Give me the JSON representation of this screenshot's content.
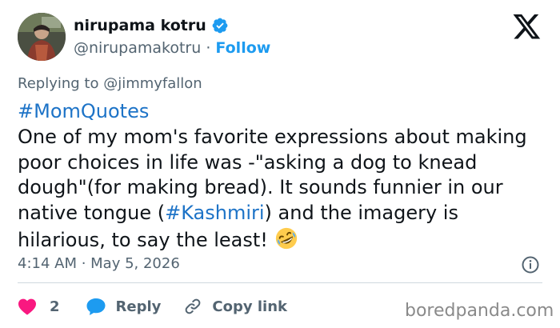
{
  "author": {
    "name": "nirupama kotru",
    "handle": "@nirupamakotru",
    "separator": " · ",
    "follow_label": "Follow"
  },
  "reply_to": "Replying to @jimmyfallon",
  "tweet": {
    "hashtag_top": "#MomQuotes",
    "text_part1": "One of my mom's favorite expressions about making poor choices in life was -\"asking a dog to knead dough\"(for making bread). It sounds funnier in our native tongue (",
    "hashtag_inline": "#Kashmiri",
    "text_part2": ") and the imagery is hilarious, to say the least! "
  },
  "timestamp": "4:14 AM · May 5, 2026",
  "actions": {
    "like_count": "2",
    "reply_label": "Reply",
    "copy_label": "Copy link"
  },
  "watermark": "boredpanda.com",
  "colors": {
    "link": "#1d73c7",
    "accent": "#1d9bf0",
    "like": "#f91880",
    "muted": "#536471"
  },
  "icons": [
    "verified-badge-icon",
    "x-logo-icon",
    "info-icon",
    "heart-icon",
    "reply-bubble-icon",
    "link-icon",
    "rofl-emoji-icon"
  ]
}
